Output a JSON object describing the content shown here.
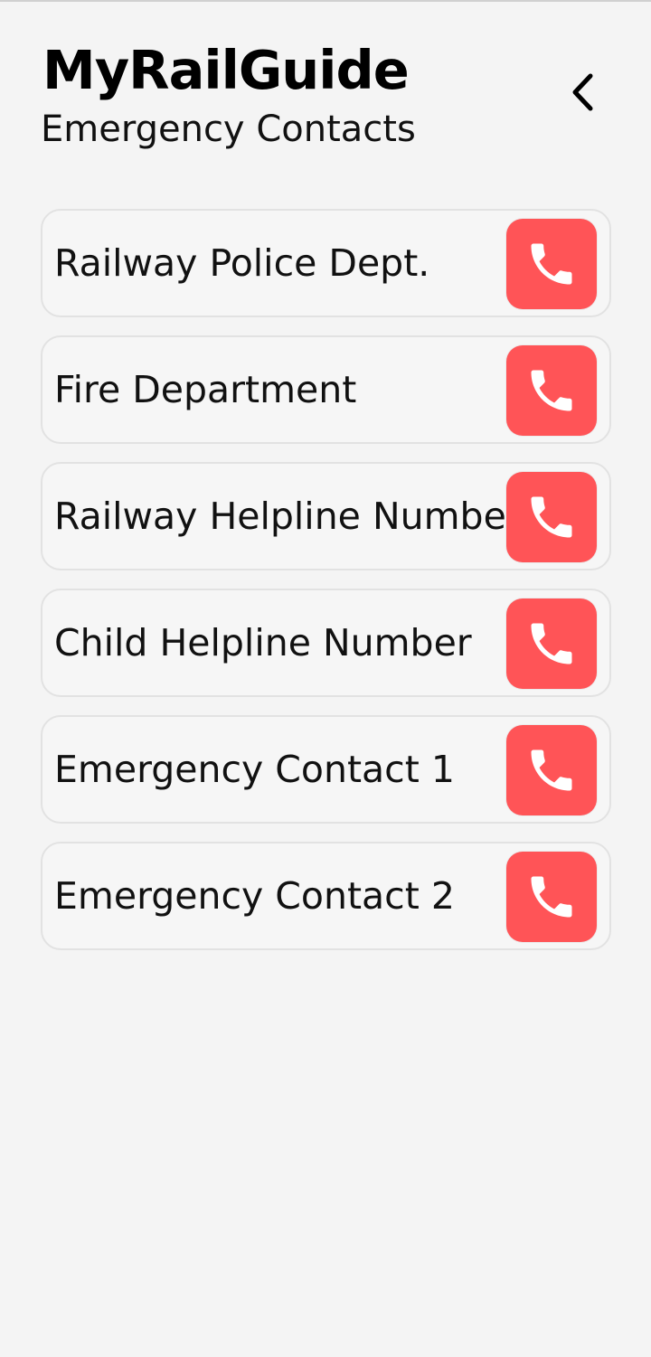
{
  "app": {
    "title": "MyRailGuide",
    "subtitle": "Emergency Contacts"
  },
  "header": {
    "back_icon": "chevron-left-icon"
  },
  "colors": {
    "background": "#f4f4f4",
    "card_border": "#e2e2e2",
    "call_button": "#ff5457",
    "text": "#111111"
  },
  "contacts": [
    {
      "label": "Railway Police Dept.",
      "icon": "phone-icon"
    },
    {
      "label": "Fire Department",
      "icon": "phone-icon"
    },
    {
      "label": "Railway Helpline Number",
      "icon": "phone-icon"
    },
    {
      "label": "Child Helpline Number",
      "icon": "phone-icon"
    },
    {
      "label": "Emergency Contact 1",
      "icon": "phone-icon"
    },
    {
      "label": "Emergency Contact 2",
      "icon": "phone-icon"
    }
  ]
}
